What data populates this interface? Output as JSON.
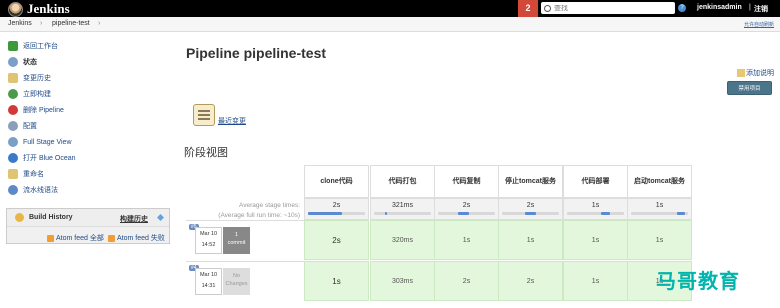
{
  "header": {
    "brand": "Jenkins",
    "notification_count": "2",
    "search_placeholder": "查找",
    "help": "?",
    "user": "jenkinsadmin",
    "separator": "|",
    "logout": "注销"
  },
  "breadcrumb": {
    "items": [
      "Jenkins",
      "pipeline-test"
    ],
    "arrow": "›",
    "auto_refresh": "允许自动刷新"
  },
  "sidebar": {
    "items": [
      {
        "label": "返回工作台",
        "icon": "up-arrow-icon",
        "color": "#3c9a3c"
      },
      {
        "label": "状态",
        "icon": "search-icon",
        "color": "#7aa0c8"
      },
      {
        "label": "变更历史",
        "icon": "notepad-icon",
        "color": "#e0c474"
      },
      {
        "label": "立即构建",
        "icon": "clock-play-icon",
        "color": "#4c9b4c"
      },
      {
        "label": "删除 Pipeline",
        "icon": "no-entry-icon",
        "color": "#d23a3a"
      },
      {
        "label": "配置",
        "icon": "gear-icon",
        "color": "#8aa0b8"
      },
      {
        "label": "Full Stage View",
        "icon": "magnifier-icon",
        "color": "#7aa0c8"
      },
      {
        "label": "打开 Blue Ocean",
        "icon": "blue-ocean-icon",
        "color": "#3a7ac8"
      },
      {
        "label": "重命名",
        "icon": "notepad-icon",
        "color": "#e0c474"
      },
      {
        "label": "流水线语法",
        "icon": "help-icon",
        "color": "#5a8ac8"
      }
    ]
  },
  "build_history": {
    "title": "Build History",
    "trend": "构建历史",
    "feed_all": "Atom feed 全部",
    "feed_failed": "Atom feed 失败"
  },
  "main": {
    "title": "Pipeline pipeline-test",
    "add_note": "添加说明",
    "disable_button": "禁用项目",
    "recent_changes": "最近变更",
    "stage_view_title": "阶段视图"
  },
  "stage_view": {
    "avg_label_1": "Average stage times:",
    "avg_label_2": "(Average full run time: ~10s)",
    "stages": [
      {
        "name": "clone代码",
        "avg": "2s",
        "bar_start": 0.0,
        "bar_fill": 0.6
      },
      {
        "name": "代码打包",
        "avg": "321ms",
        "bar_start": 0.2,
        "bar_fill": 0.03
      },
      {
        "name": "代码复制",
        "avg": "2s",
        "bar_start": 0.35,
        "bar_fill": 0.2
      },
      {
        "name": "停止tomcat服务",
        "avg": "2s",
        "bar_start": 0.4,
        "bar_fill": 0.2
      },
      {
        "name": "代码部署",
        "avg": "1s",
        "bar_start": 0.6,
        "bar_fill": 0.15
      },
      {
        "name": "启动tomcat服务",
        "avg": "1s",
        "bar_start": 0.8,
        "bar_fill": 0.15
      }
    ],
    "runs": [
      {
        "num": "#5",
        "date": "Mar 10",
        "time": "14:52",
        "commit_count": "1",
        "commit_label": "commit",
        "cells": [
          "2s",
          "320ms",
          "1s",
          "1s",
          "1s",
          "1s"
        ]
      },
      {
        "num": "#4",
        "date": "Mar 10",
        "time": "14:31",
        "commit_count": "No",
        "commit_label": "Changes",
        "cells": [
          "1s",
          "303ms",
          "2s",
          "2s",
          "1s",
          "1s"
        ]
      }
    ]
  },
  "watermark": "马哥教育"
}
